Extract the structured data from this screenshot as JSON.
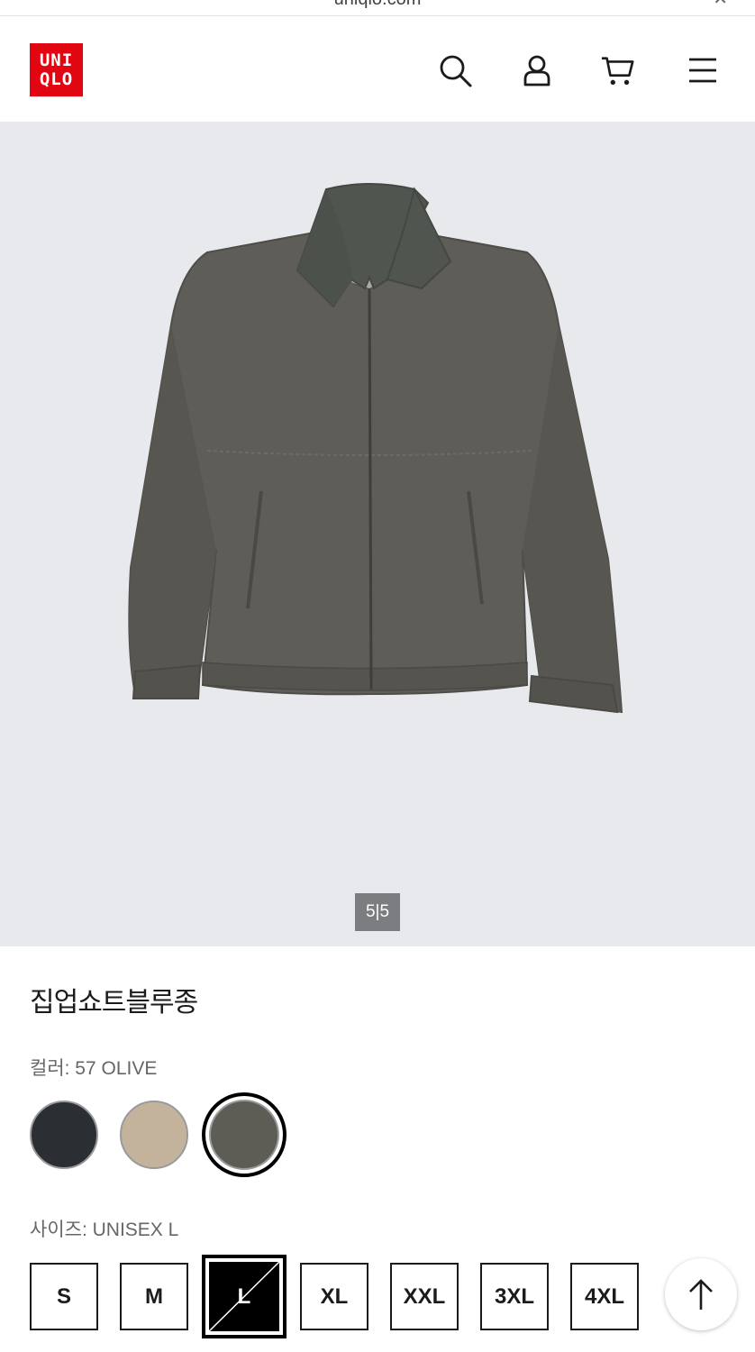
{
  "browser": {
    "url": "uniqlo.com",
    "close_glyph": "✕"
  },
  "header": {
    "logo_line1": "UNI",
    "logo_line2": "QLO",
    "brand_color": "#e20613",
    "icons": [
      "search-icon",
      "user-icon",
      "cart-icon",
      "menu-icon"
    ]
  },
  "gallery": {
    "counter_current": "5",
    "counter_total": "5",
    "counter_text": "5|5",
    "background": "#e8e9ec"
  },
  "product": {
    "title": "집업쇼트블루종",
    "color_label": "컬러: 57 OLIVE",
    "colors": [
      {
        "name": "navy",
        "hex": "#2b2e33",
        "selected": false
      },
      {
        "name": "beige",
        "hex": "#c3b39d",
        "selected": false
      },
      {
        "name": "57 OLIVE",
        "hex": "#5d5c55",
        "selected": true
      }
    ],
    "size_label": "사이즈: UNISEX L",
    "sizes": [
      {
        "label": "S",
        "selected": false
      },
      {
        "label": "M",
        "selected": false
      },
      {
        "label": "L",
        "selected": true,
        "out_of_stock": true
      },
      {
        "label": "XL",
        "selected": false
      },
      {
        "label": "XXL",
        "selected": false
      },
      {
        "label": "3XL",
        "selected": false
      },
      {
        "label": "4XL",
        "selected": false
      }
    ]
  },
  "scroll_top": {
    "icon": "arrow-up-icon"
  }
}
